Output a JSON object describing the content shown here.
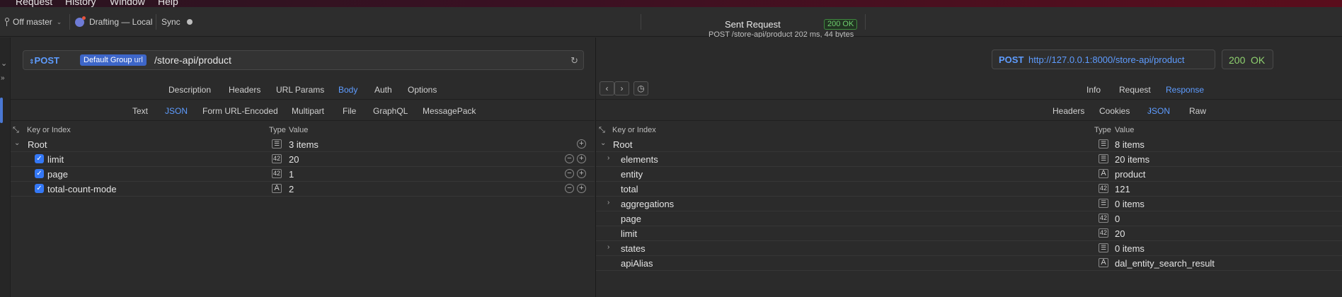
{
  "menubar": {
    "items": [
      "Request",
      "History",
      "Window",
      "Help"
    ]
  },
  "titlebar": {
    "branch": "Off master",
    "workspace": "Drafting — Local",
    "sync": "Sync",
    "sent_title": "Sent Request",
    "sent_status": "200 OK",
    "sent_sub": "POST /store-api/product 202 ms, 44 bytes"
  },
  "request": {
    "method": "POST",
    "env_chip": "Default Group",
    "env_suffix": "url",
    "path": "/store-api/product",
    "tabs": [
      "Description",
      "Headers",
      "URL Params",
      "Body",
      "Auth",
      "Options"
    ],
    "active_tab": "Body",
    "body_types": [
      "Text",
      "JSON",
      "Form URL-Encoded",
      "Multipart",
      "File",
      "GraphQL",
      "MessagePack"
    ],
    "active_body_type": "JSON",
    "columns": {
      "key": "Key or Index",
      "type": "Type",
      "value": "Value"
    },
    "root": {
      "key": "Root",
      "type_icon": "list-icon",
      "value": "3 items"
    },
    "rows": [
      {
        "key": "limit",
        "type": "42",
        "value": "20"
      },
      {
        "key": "page",
        "type": "42",
        "value": "1"
      },
      {
        "key": "total-count-mode",
        "type": "A",
        "value": "2"
      }
    ]
  },
  "response": {
    "method": "POST",
    "url": "http://127.0.0.1:8000/store-api/product",
    "status_code": "200",
    "status_text": "OK",
    "view_tabs": [
      "Info",
      "Request",
      "Response"
    ],
    "active_view_tab": "Response",
    "sub_tabs": [
      "Headers",
      "Cookies",
      "JSON",
      "Raw"
    ],
    "active_sub_tab": "JSON",
    "columns": {
      "key": "Key or Index",
      "type": "Type",
      "value": "Value"
    },
    "root": {
      "key": "Root",
      "value": "8 items"
    },
    "rows": [
      {
        "key": "elements",
        "type": "list",
        "value": "20 items",
        "expandable": true
      },
      {
        "key": "entity",
        "type": "A",
        "value": "product",
        "expandable": false
      },
      {
        "key": "total",
        "type": "42",
        "value": "121",
        "expandable": false
      },
      {
        "key": "aggregations",
        "type": "list",
        "value": "0 items",
        "expandable": true
      },
      {
        "key": "page",
        "type": "42",
        "value": "0",
        "expandable": false
      },
      {
        "key": "limit",
        "type": "42",
        "value": "20",
        "expandable": false
      },
      {
        "key": "states",
        "type": "list",
        "value": "0 items",
        "expandable": true
      },
      {
        "key": "apiAlias",
        "type": "A",
        "value": "dal_entity_search_result",
        "expandable": false
      }
    ]
  },
  "colors": {
    "accent": "#5e9cff",
    "status_ok": "#6fcf6f",
    "chip": "#3d66c9"
  }
}
